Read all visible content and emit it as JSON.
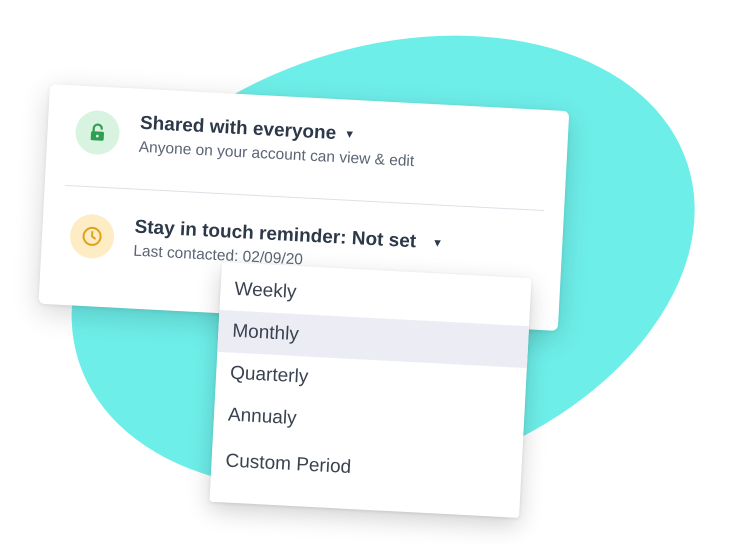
{
  "shared": {
    "title": "Shared with everyone",
    "subtitle": "Anyone on your account can view & edit",
    "icon": "unlocked-lock-icon",
    "icon_color": "#2e9e52",
    "icon_bg": "#d8f3df"
  },
  "reminder": {
    "title": "Stay in touch reminder: Not set",
    "subtitle": "Last contacted: 02/09/20",
    "icon": "clock-icon",
    "icon_color": "#e0a21a",
    "icon_bg": "#fdecc4"
  },
  "dropdown": {
    "selected": "Monthly",
    "options": [
      "Weekly",
      "Monthly",
      "Quarterly",
      "Annualy",
      "Custom Period"
    ]
  },
  "colors": {
    "blob": "#6eeee9",
    "text": "#2d3848",
    "highlight": "#ecedf4"
  }
}
